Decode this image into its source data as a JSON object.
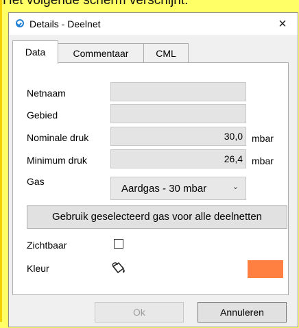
{
  "background_caption": "Het volgende scherm verschijnt:",
  "window": {
    "title": "Details - Deelnet",
    "close_glyph": "×"
  },
  "tabs": [
    {
      "label": "Data",
      "active": true
    },
    {
      "label": "Commentaar",
      "active": false
    },
    {
      "label": "CML",
      "active": false
    }
  ],
  "form": {
    "netnaam": {
      "label": "Netnaam",
      "value": ""
    },
    "gebied": {
      "label": "Gebied",
      "value": ""
    },
    "nominale_druk": {
      "label": "Nominale druk",
      "value": "30,0",
      "unit": "mbar"
    },
    "minimum_druk": {
      "label": "Minimum druk",
      "value": "26,4",
      "unit": "mbar"
    },
    "gas": {
      "label": "Gas",
      "selected": "Aardgas - 30 mbar"
    },
    "apply_button": "Gebruik geselecteerd gas voor alle deelnetten",
    "zichtbaar": {
      "label": "Zichtbaar",
      "checked": false
    },
    "kleur": {
      "label": "Kleur",
      "icon": "paint-bucket-icon",
      "color": "#ff8040"
    }
  },
  "buttons": {
    "ok": "Ok",
    "cancel": "Annuleren"
  },
  "colors": {
    "page_background": "#ffff66",
    "accent_blue": "#1f7fd1",
    "swatch": "#ff8040"
  }
}
